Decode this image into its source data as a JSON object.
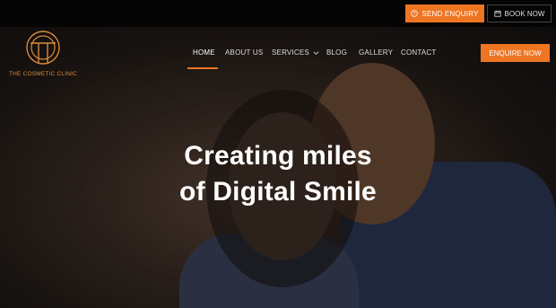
{
  "topbar": {
    "send_enquiry_label": "SEND ENQUIRY",
    "book_now_label": "BOOK NOW"
  },
  "logo": {
    "text": "THE COSMETIC CLINIC"
  },
  "nav": {
    "items": [
      {
        "label": "HOME"
      },
      {
        "label": "ABOUT US"
      },
      {
        "label": "SERVICES"
      },
      {
        "label": "BLOG"
      },
      {
        "label": "GALLERY"
      },
      {
        "label": "CONTACT"
      }
    ],
    "active": "HOME",
    "enquire_now_label": "ENQUIRE NOW"
  },
  "hero": {
    "line1": "Creating miles",
    "line2": "of Digital Smile"
  },
  "colors": {
    "accent": "#ee7522",
    "topbar": "#050505"
  },
  "icons": {
    "send_enquiry": "question-circle-icon",
    "book_now": "calendar-icon",
    "services_dropdown": "chevron-down-icon"
  }
}
